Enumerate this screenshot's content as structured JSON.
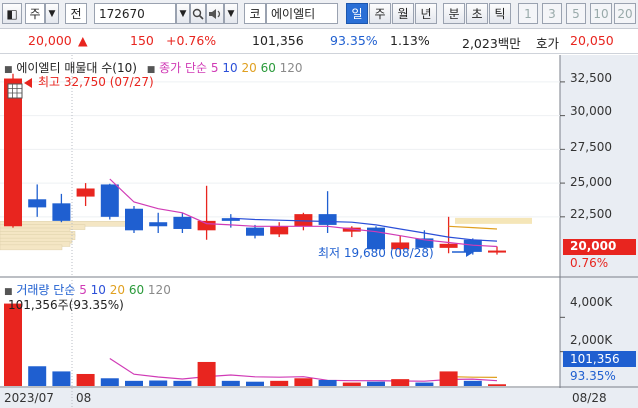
{
  "toolbar": {
    "code_type": "주",
    "period": "전",
    "stock_code": "172670",
    "market": "코",
    "stock_name": "에이엘티",
    "periods": [
      "일",
      "주",
      "월",
      "년",
      "분",
      "초",
      "틱"
    ],
    "active_period": "일",
    "intervals": [
      "1",
      "3",
      "5",
      "10",
      "20"
    ]
  },
  "quote": {
    "price": "20,000",
    "arrow": "▲",
    "change": "150",
    "change_pct": "+0.76%",
    "volume": "101,356",
    "vol_ratio": "93.35%",
    "turnover": "1.13%",
    "amount": "2,023백만",
    "ask_label": "호가",
    "ask_price": "20,050"
  },
  "legend": {
    "price_title": "에이엘티 매물대 수(10)",
    "ma_prefix": "종가 단순",
    "ma_periods": [
      "5",
      "10",
      "20",
      "60",
      "120"
    ],
    "ma_colors": [
      "#d03bb6",
      "#2b4fd8",
      "#e0a020",
      "#2a9a3a",
      "#8a8a8a"
    ],
    "high_label": "최고 32,750 (07/27)",
    "low_label": "최저 19,680 (08/28)",
    "volume_title": "거래량 단순",
    "volume_value": "101,356주(93.35%)"
  },
  "price_axis": {
    "ticks": [
      "32,500",
      "30,000",
      "27,500",
      "25,000",
      "22,500"
    ],
    "current_price": "20,000",
    "current_pct": "0.76%"
  },
  "volume_axis": {
    "ticks": [
      "4,000K",
      "2,000K"
    ],
    "current_volume": "101,356",
    "current_pct": "93.35%"
  },
  "date_axis": {
    "labels": [
      "2023/07",
      "08"
    ],
    "right_label": "08/28"
  },
  "chart_data": {
    "type": "candlestick",
    "candles": [
      {
        "o": 21800,
        "h": 33100,
        "l": 21700,
        "c": 32750,
        "v": 4800
      },
      {
        "o": 23800,
        "h": 24900,
        "l": 22500,
        "c": 23200,
        "v": 1150
      },
      {
        "o": 23500,
        "h": 24200,
        "l": 22100,
        "c": 22200,
        "v": 850
      },
      {
        "o": 24000,
        "h": 25000,
        "l": 23300,
        "c": 24600,
        "v": 700
      },
      {
        "o": 24900,
        "h": 24950,
        "l": 22300,
        "c": 22500,
        "v": 450
      },
      {
        "o": 23100,
        "h": 23300,
        "l": 21300,
        "c": 21500,
        "v": 300
      },
      {
        "o": 22100,
        "h": 22800,
        "l": 21300,
        "c": 21800,
        "v": 320
      },
      {
        "o": 22500,
        "h": 22800,
        "l": 21300,
        "c": 21600,
        "v": 300
      },
      {
        "o": 21500,
        "h": 24800,
        "l": 20800,
        "c": 22200,
        "v": 1400
      },
      {
        "o": 22400,
        "h": 22700,
        "l": 21700,
        "c": 22200,
        "v": 300
      },
      {
        "o": 21700,
        "h": 21900,
        "l": 20900,
        "c": 21100,
        "v": 250
      },
      {
        "o": 21200,
        "h": 22100,
        "l": 21000,
        "c": 21800,
        "v": 300
      },
      {
        "o": 21800,
        "h": 22800,
        "l": 21500,
        "c": 22700,
        "v": 450
      },
      {
        "o": 22700,
        "h": 24400,
        "l": 21300,
        "c": 21900,
        "v": 350
      },
      {
        "o": 21400,
        "h": 21800,
        "l": 21000,
        "c": 21700,
        "v": 200
      },
      {
        "o": 21700,
        "h": 21800,
        "l": 20000,
        "c": 20100,
        "v": 250
      },
      {
        "o": 20100,
        "h": 21100,
        "l": 19700,
        "c": 20600,
        "v": 400
      },
      {
        "o": 20900,
        "h": 21500,
        "l": 20200,
        "c": 20200,
        "v": 200
      },
      {
        "o": 20200,
        "h": 22500,
        "l": 19800,
        "c": 20500,
        "v": 850
      },
      {
        "o": 20800,
        "h": 20900,
        "l": 19700,
        "c": 19900,
        "v": 300
      },
      {
        "o": 19850,
        "h": 20300,
        "l": 19700,
        "c": 20000,
        "v": 101
      }
    ],
    "ma5": [
      null,
      null,
      null,
      null,
      25300,
      23600,
      23100,
      22800,
      22000,
      21900,
      21800,
      21800,
      21800,
      21800,
      21600,
      21400,
      21100,
      20800,
      20600,
      20400,
      20300
    ],
    "ma10": [
      null,
      null,
      null,
      null,
      null,
      null,
      null,
      null,
      null,
      22400,
      22300,
      22250,
      22200,
      22150,
      22100,
      21900,
      21600,
      21300,
      21000,
      20800,
      20700
    ],
    "ma20_tail": [
      21800,
      21700,
      21600
    ],
    "volume_ma5": [
      null,
      null,
      null,
      null,
      1600,
      690,
      525,
      410,
      550,
      640,
      535,
      515,
      540,
      330,
      310,
      310,
      290,
      280,
      380,
      400,
      310
    ],
    "volume_ma20_tail": [
      550,
      510,
      500
    ],
    "price_ylim": [
      19300,
      33900
    ],
    "volume_ylim": [
      0,
      5300
    ],
    "volume_unit": "K"
  },
  "colors": {
    "up": "#e8251f",
    "down": "#1f5fd0",
    "volume_up": "#e8251f",
    "volume_down": "#1f5fd0",
    "axis_bg": "#e9edf3",
    "price_tag_bg": "#e8251f",
    "volume_tag_bg": "#1f5fd0"
  }
}
